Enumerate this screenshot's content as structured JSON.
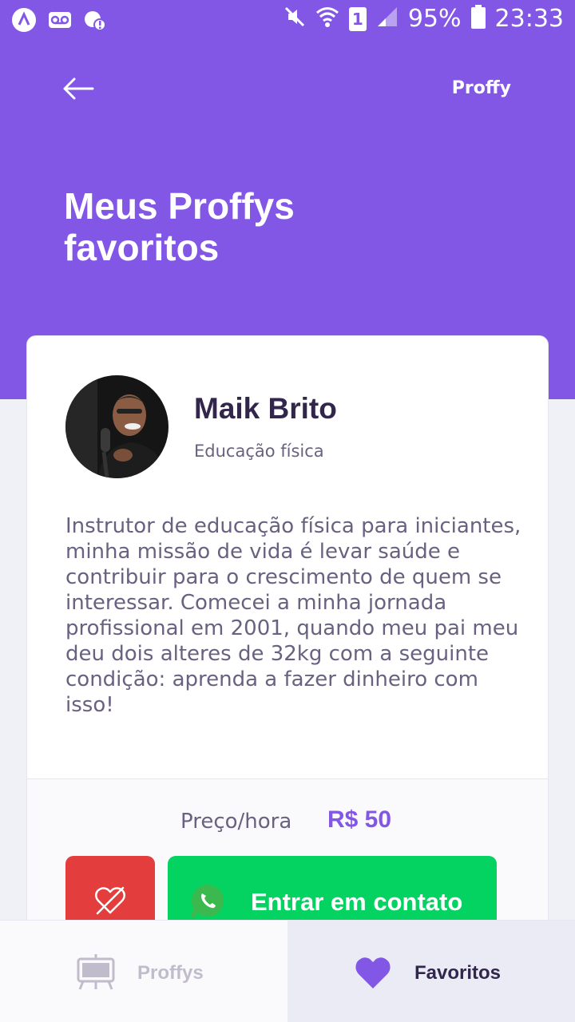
{
  "status_bar": {
    "battery": "95%",
    "time": "23:33",
    "sim_slot": "1"
  },
  "header": {
    "logo": "Proffy",
    "title": "Meus Proffys favoritos"
  },
  "teacher": {
    "name": "Maik Brito",
    "subject": "Educação física",
    "bio": "Instrutor de educação física para iniciantes, minha missão de vida é levar saúde e contribuir para o crescimento de quem se interessar. Comecei a minha jornada profissional em 2001, quando meu pai meu deu dois alteres de 32kg com a seguinte condição: aprenda a fazer dinheiro com isso!",
    "price_label": "Preço/hora",
    "price_value": "R$ 50",
    "contact_label": "Entrar em contato"
  },
  "tabs": [
    {
      "label": "Proffys",
      "icon": "tv-icon",
      "active": false
    },
    {
      "label": "Favoritos",
      "icon": "heart-icon",
      "active": true
    }
  ],
  "colors": {
    "primary": "#8257E5",
    "danger": "#E33D3D",
    "success": "#04D361",
    "title_text": "#32264D",
    "body_text": "#6A6180",
    "muted": "#C1BCCC"
  }
}
